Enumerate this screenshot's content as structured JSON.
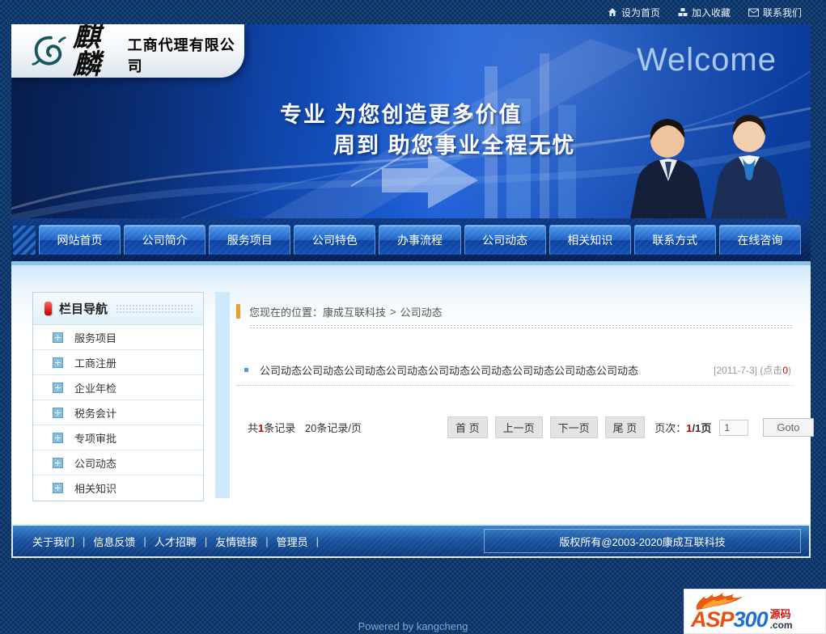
{
  "topbar": {
    "set_home": "设为首页",
    "add_favorite": "加入收藏",
    "contact_us": "联系我们"
  },
  "header": {
    "brand_name": "麒麟",
    "brand_suffix": "工商代理有限公司",
    "welcome": "Welcome",
    "slogan_line1": "专业 为您创造更多价值",
    "slogan_line2": "周到 助您事业全程无忧"
  },
  "nav": {
    "items": [
      "网站首页",
      "公司简介",
      "服务项目",
      "公司特色",
      "办事流程",
      "公司动态",
      "相关知识",
      "联系方式",
      "在线咨询"
    ]
  },
  "sidebar": {
    "title": "栏目导航",
    "items": [
      "服务项目",
      "工商注册",
      "企业年检",
      "税务会计",
      "专项审批",
      "公司动态",
      "相关知识"
    ]
  },
  "main": {
    "breadcrumb": {
      "prefix": "您现在的位置：",
      "site": "康成互联科技",
      "separator": ">",
      "current": "公司动态"
    },
    "news": {
      "title": "公司动态公司动态公司动态公司动态公司动态公司动态公司动态公司动态公司动态",
      "date": "[2011-7-3]",
      "clicks_open": "(点击",
      "clicks_count": "0",
      "clicks_close": ")"
    },
    "pagination": {
      "sum_prefix": "共",
      "sum_count": "1",
      "sum_suffix": "条记录",
      "per_page": "20条记录/页",
      "first": "首 页",
      "prev": "上一页",
      "next": "下一页",
      "last": "尾 页",
      "page_label": "页次：",
      "page_current": "1",
      "page_rest": "/1页",
      "goto_value": "1",
      "goto_label": "Goto"
    }
  },
  "footer": {
    "links": [
      "关于我们",
      "信息反馈",
      "人才招聘",
      "友情链接",
      "管理员"
    ],
    "separator": "|",
    "copyright": "版权所有@2003-2020康成互联科技",
    "powered_by": "Powered by kangcheng"
  },
  "badge": {
    "asp": "ASP",
    "num": "300",
    "cn": "源码",
    "com": ".com"
  },
  "colors": {
    "accent_red": "#c80000",
    "banner_blue": "#0d47a8",
    "nav_navy": "#092a68",
    "marker_orange": "#e8a22c",
    "light_blue_panel": "#cde9fb"
  }
}
